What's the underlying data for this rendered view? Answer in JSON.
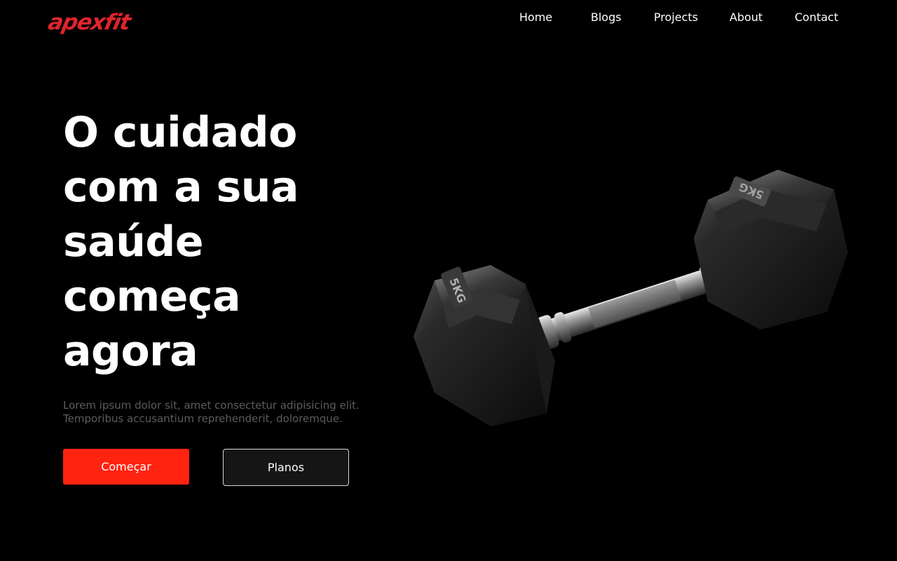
{
  "brand": {
    "name": "apexfit",
    "color": "#e0242c"
  },
  "nav": {
    "items": [
      {
        "label": "Home"
      },
      {
        "label": "Blogs"
      },
      {
        "label": "Projects"
      },
      {
        "label": "About"
      },
      {
        "label": "Contact"
      }
    ]
  },
  "hero": {
    "title": "O cuidado com a sua saúde começa agora",
    "subtitle_line1": "Lorem ipsum dolor sit, amet consectetur adipisicing elit.",
    "subtitle_line2": "Temporibus accusantium reprehenderit, doloremque.",
    "primary_button": "Começar",
    "secondary_button": "Planos",
    "accent_color": "#ff2310",
    "image": {
      "name": "dumbbell-image",
      "weight_label": "5KG"
    }
  }
}
